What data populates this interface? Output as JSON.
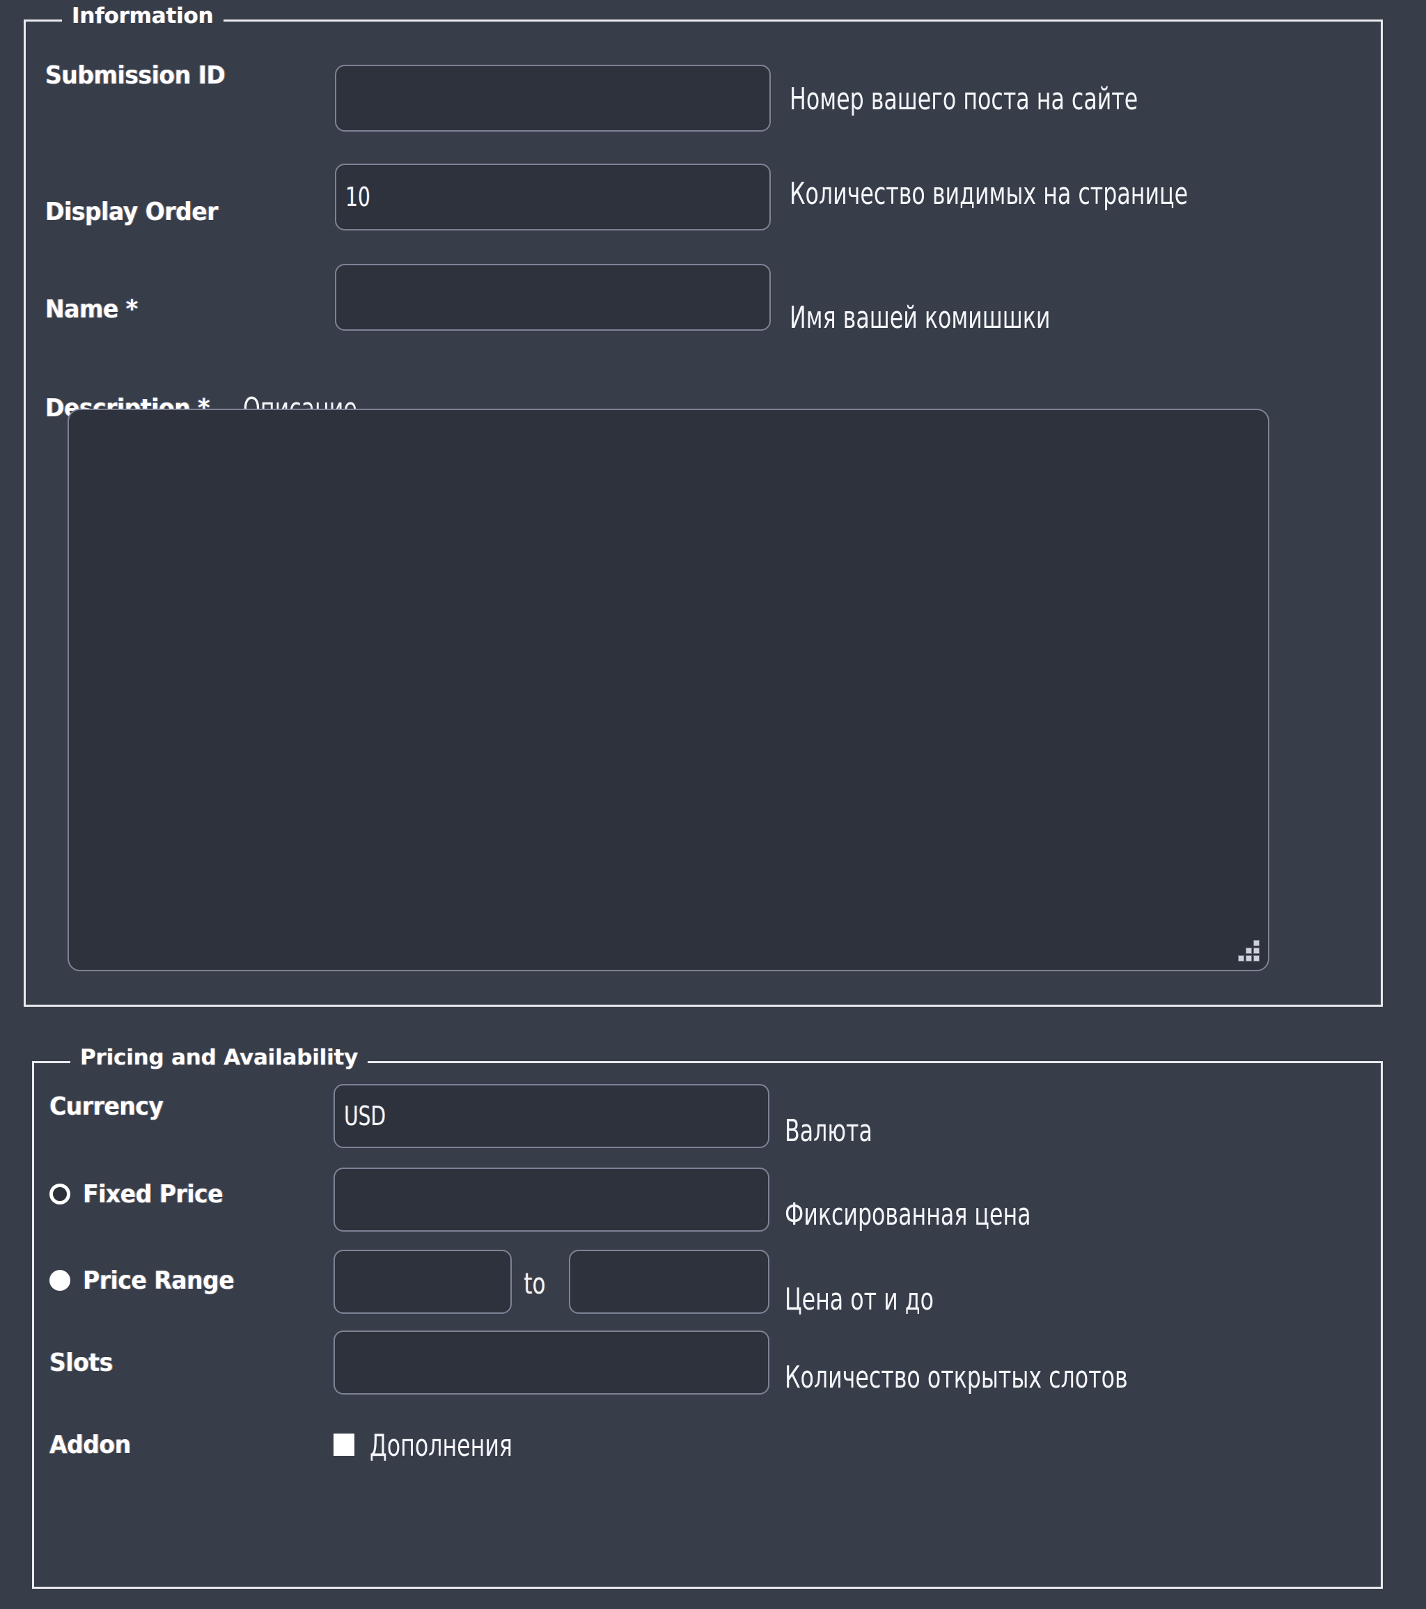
{
  "sections": {
    "information": {
      "legend": "Information",
      "fields": {
        "submission_id": {
          "label": "Submission ID",
          "value": "",
          "annotation": "Номер вашего поста на сайте"
        },
        "display_order": {
          "label": "Display Order",
          "value": "10",
          "annotation": "Количество видимых на странице"
        },
        "name": {
          "label": "Name *",
          "value": "",
          "annotation": "Имя вашей комишшки"
        },
        "description": {
          "label": "Description *",
          "value": "",
          "annotation": "Описание",
          "resize_grip_icon": "resize-grip-icon"
        }
      }
    },
    "pricing": {
      "legend": "Pricing and Availability",
      "fields": {
        "currency": {
          "label": "Currency",
          "value": "USD",
          "annotation": "Валюта"
        },
        "fixed_price": {
          "label": "Fixed Price",
          "value": "",
          "annotation": "Фиксированная цена",
          "selected": false,
          "radio_icon": "radio-unchecked-icon"
        },
        "price_range": {
          "label": "Price Range",
          "min_value": "",
          "max_value": "",
          "separator": "to",
          "annotation": "Цена от и до",
          "selected": true,
          "radio_icon": "radio-checked-icon"
        },
        "slots": {
          "label": "Slots",
          "value": "",
          "annotation": "Количество открытых слотов"
        },
        "addon": {
          "label": "Addon",
          "checked": true,
          "checkbox_icon": "checkbox-checked-icon",
          "annotation": "Дополнения"
        }
      }
    }
  },
  "colors": {
    "background": "#373d49",
    "field_background": "#2d323c",
    "field_border": "#7e8296",
    "panel_border": "#e9eaee",
    "text": "#f4f5f8"
  }
}
